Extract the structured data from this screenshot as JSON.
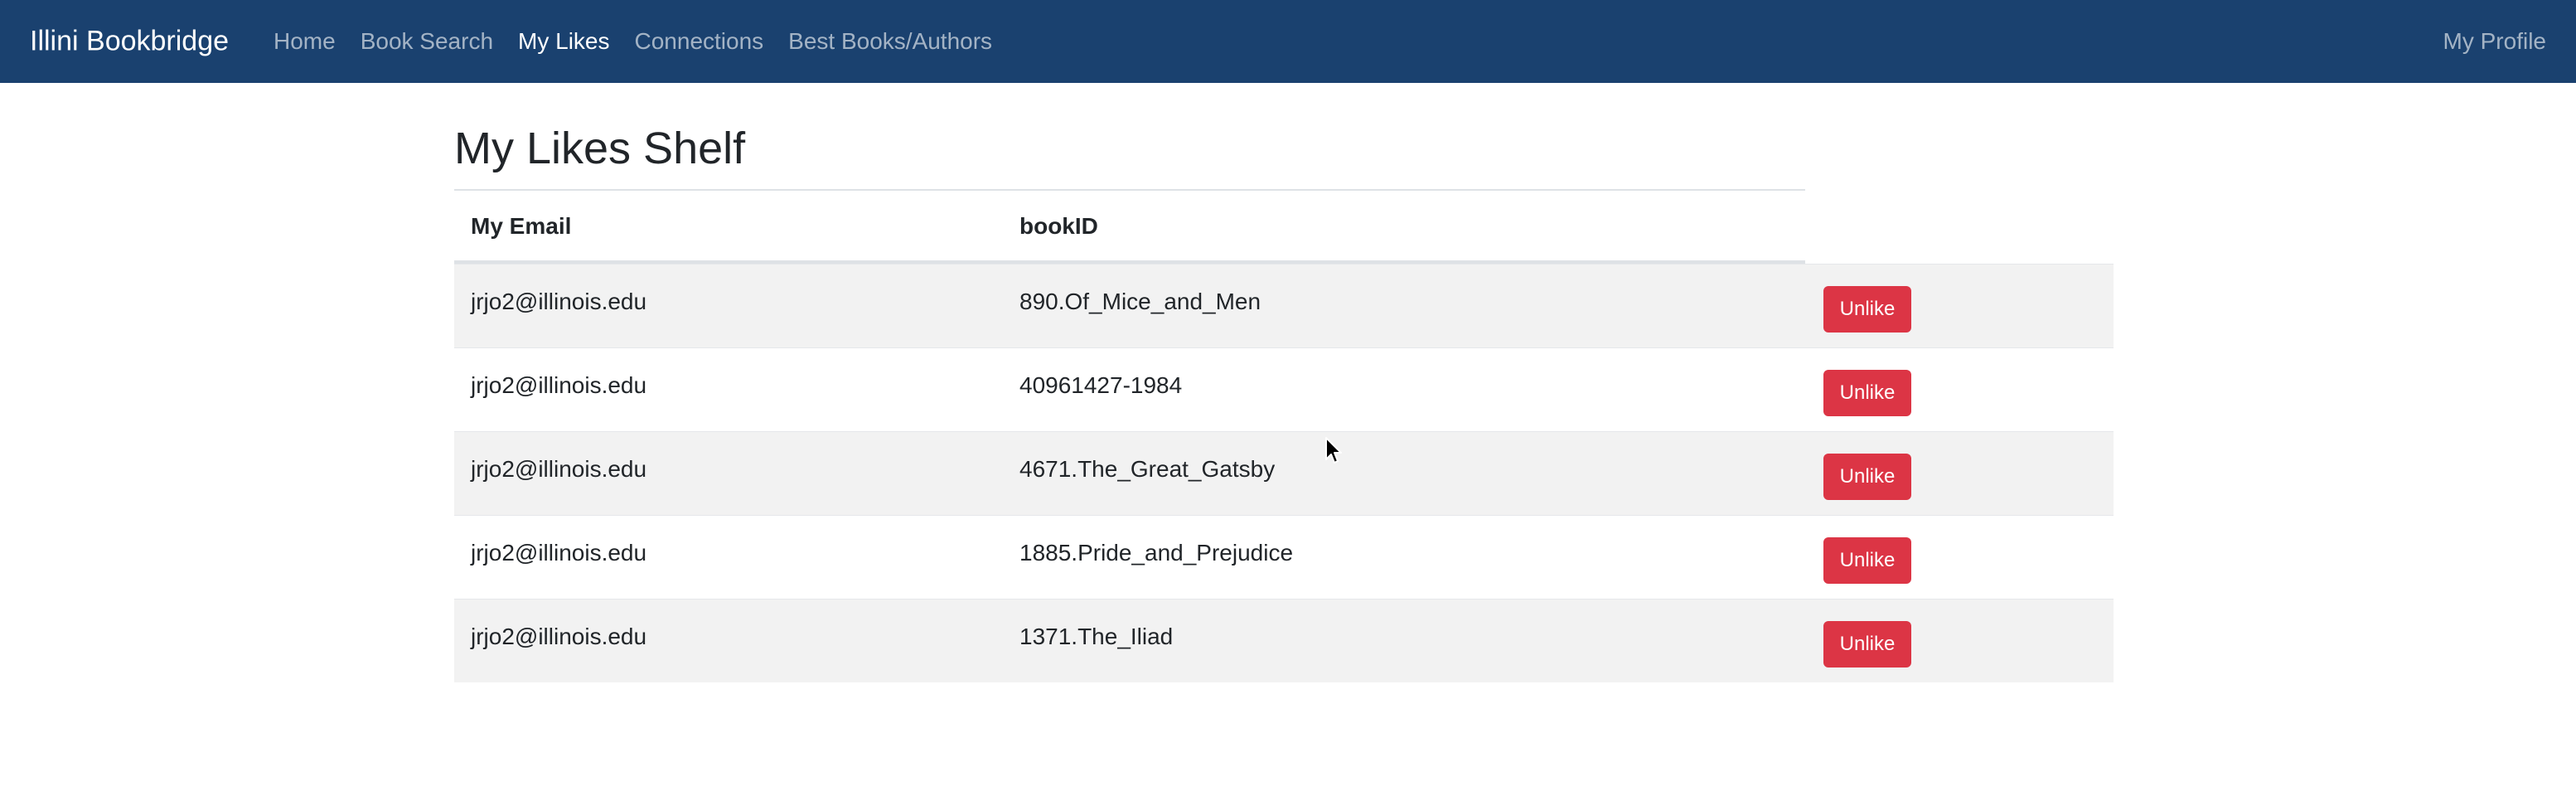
{
  "navbar": {
    "brand": "Illini Bookbridge",
    "links": [
      {
        "label": "Home",
        "active": false
      },
      {
        "label": "Book Search",
        "active": false
      },
      {
        "label": "My Likes",
        "active": true
      },
      {
        "label": "Connections",
        "active": false
      },
      {
        "label": "Best Books/Authors",
        "active": false
      }
    ],
    "profile": "My Profile",
    "background_color": "#1a416f"
  },
  "page": {
    "title": "My Likes Shelf"
  },
  "table": {
    "headers": {
      "email": "My Email",
      "book": "bookID"
    },
    "rows": [
      {
        "email": "jrjo2@illinois.edu",
        "book": "890.Of_Mice_and_Men",
        "action": "Unlike"
      },
      {
        "email": "jrjo2@illinois.edu",
        "book": "40961427-1984",
        "action": "Unlike"
      },
      {
        "email": "jrjo2@illinois.edu",
        "book": "4671.The_Great_Gatsby",
        "action": "Unlike"
      },
      {
        "email": "jrjo2@illinois.edu",
        "book": "1885.Pride_and_Prejudice",
        "action": "Unlike"
      },
      {
        "email": "jrjo2@illinois.edu",
        "book": "1371.The_Iliad",
        "action": "Unlike"
      }
    ],
    "button_color": "#dc3545",
    "stripe_color": "#f2f2f2"
  },
  "icons": {
    "cursor": "mouse-pointer-icon"
  }
}
